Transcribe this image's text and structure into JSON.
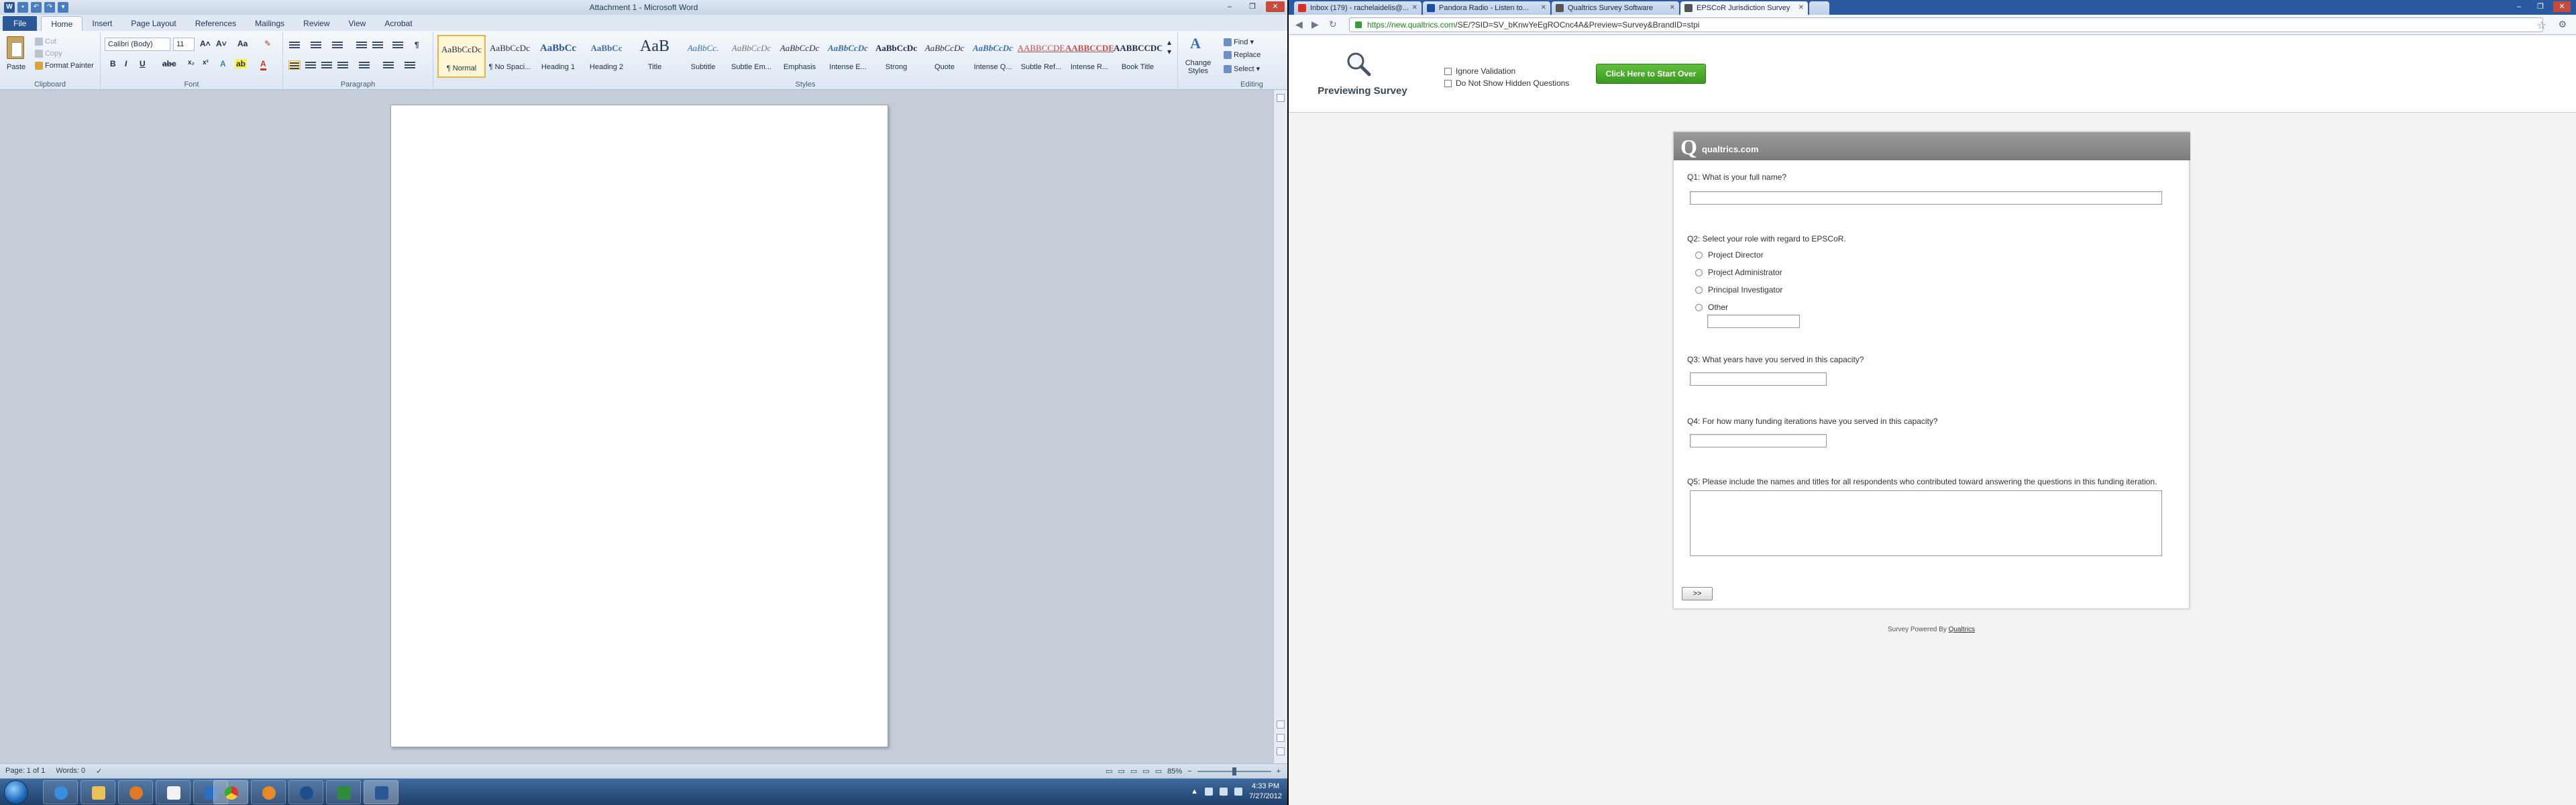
{
  "word": {
    "title": "Attachment 1 - Microsoft Word",
    "tabs": [
      "File",
      "Home",
      "Insert",
      "Page Layout",
      "References",
      "Mailings",
      "Review",
      "View",
      "Acrobat"
    ],
    "clipboard": {
      "paste": "Paste",
      "cut": "Cut",
      "copy": "Copy",
      "format_painter": "Format Painter",
      "label": "Clipboard"
    },
    "font": {
      "family": "Calibri (Body)",
      "size": "11",
      "label": "Font"
    },
    "paragraph_label": "Paragraph",
    "styles": [
      {
        "sample": "AaBbCcDc",
        "name": "¶ Normal"
      },
      {
        "sample": "AaBbCcDc",
        "name": "¶ No Spaci..."
      },
      {
        "sample": "AaBbCc",
        "name": "Heading 1"
      },
      {
        "sample": "AaBbCc",
        "name": "Heading 2"
      },
      {
        "sample": "AaB",
        "name": "Title"
      },
      {
        "sample": "AaBbCc.",
        "name": "Subtitle"
      },
      {
        "sample": "AaBbCcDc",
        "name": "Subtle Em..."
      },
      {
        "sample": "AaBbCcDc",
        "name": "Emphasis"
      },
      {
        "sample": "AaBbCcDc",
        "name": "Intense E..."
      },
      {
        "sample": "AaBbCcDc",
        "name": "Strong"
      },
      {
        "sample": "AaBbCcDc",
        "name": "Quote"
      },
      {
        "sample": "AaBbCcDc",
        "name": "Intense Q..."
      },
      {
        "sample": "AABBCCDE",
        "name": "Subtle Ref..."
      },
      {
        "sample": "AABBCCDE",
        "name": "Intense R..."
      },
      {
        "sample": "AABBCCDC",
        "name": "Book Title"
      }
    ],
    "styles_label": "Styles",
    "change_styles": "Change Styles",
    "editing": {
      "find": "Find",
      "replace": "Replace",
      "select": "Select",
      "label": "Editing"
    },
    "status": {
      "page": "Page: 1 of 1",
      "words": "Words: 0",
      "zoom": "85%"
    }
  },
  "taskbar": {
    "time": "4:33 PM",
    "date": "7/27/2012"
  },
  "chrome": {
    "tabs": [
      {
        "label": "Inbox (179) - rachelaidelis@...",
        "active": false
      },
      {
        "label": "Pandora Radio - Listen to...",
        "active": false
      },
      {
        "label": "Qualtrics Survey Software",
        "active": false
      },
      {
        "label": "EPSCoR Jurisdiction Survey",
        "active": true
      }
    ],
    "url_host": "https://new.qualtrics.com",
    "url_path": "/SE/?SID=SV_bKnwYeEgROCnc4A&Preview=Survey&BrandID=stpi"
  },
  "preview": {
    "title": "Previewing Survey",
    "ignore_validation": "Ignore Validation",
    "hide_hidden": "Do Not Show Hidden Questions",
    "start_over": "Click Here to Start Over"
  },
  "survey": {
    "logo_letter": "Q",
    "logo_text": "qualtrics.com",
    "q1": "Q1: What is your full name?",
    "q2": "Q2: Select your role with regard to EPSCoR.",
    "q2_options": [
      "Project Director",
      "Project Administrator",
      "Principal Investigator",
      "Other"
    ],
    "q3": "Q3: What years have you served in this capacity?",
    "q4": "Q4: For how many funding iterations have you served in this capacity?",
    "q5": "Q5: Please include the names and titles for all respondents who contributed toward answering the questions in this funding iteration.",
    "next": ">>",
    "powered_prefix": "Survey Powered By",
    "powered_link": "Qualtrics"
  }
}
